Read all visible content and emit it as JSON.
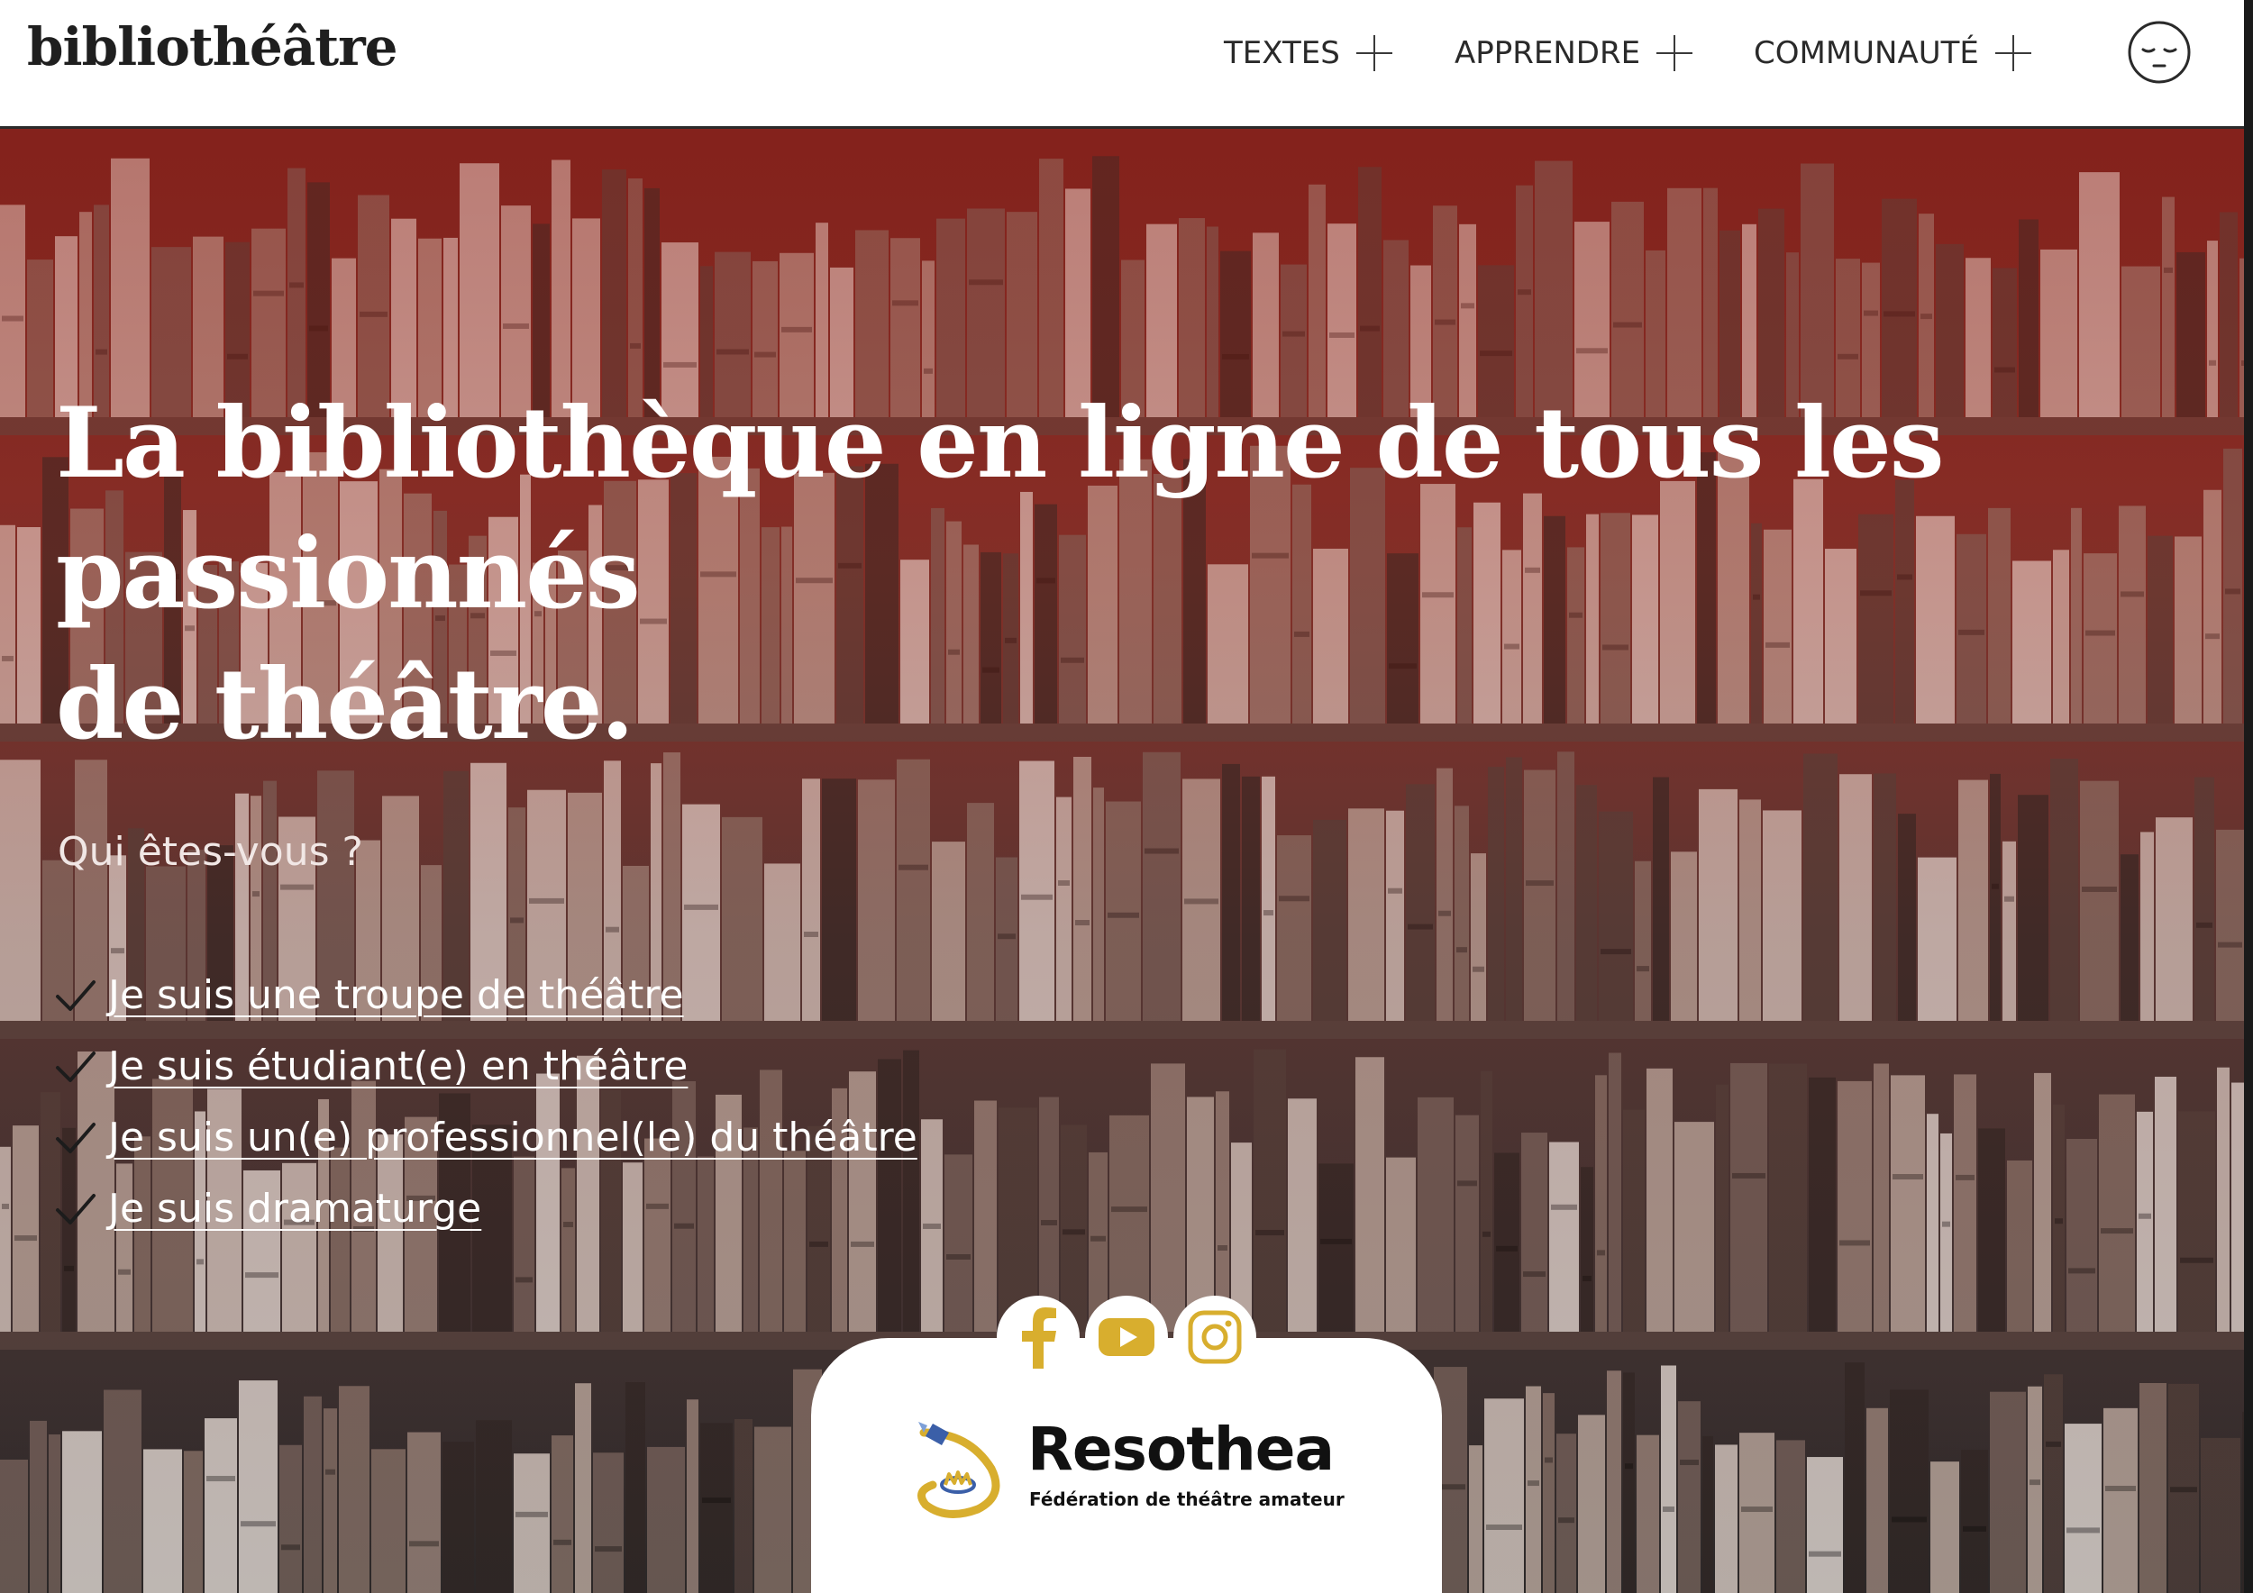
{
  "header": {
    "logo": "bibliothéâtre",
    "nav": [
      {
        "label": "TEXTES"
      },
      {
        "label": "APPRENDRE"
      },
      {
        "label": "COMMUNAUTÉ"
      }
    ],
    "user_icon": "sleepy-face-icon"
  },
  "hero": {
    "title_line1": "La bibliothèque en ligne de tous les passionnés",
    "title_line2": "de théâtre.",
    "question": "Qui êtes-vous ?",
    "choices": [
      {
        "label": "Je suis une troupe de théâtre"
      },
      {
        "label": "Je suis étudiant(e) en théâtre"
      },
      {
        "label": "Je suis un(e) professionnel(le) du théâtre"
      },
      {
        "label": "Je suis dramaturge"
      }
    ],
    "check_icon": "checkmark-icon"
  },
  "footer": {
    "social": [
      {
        "icon": "facebook-icon"
      },
      {
        "icon": "youtube-icon"
      },
      {
        "icon": "instagram-icon"
      }
    ],
    "partner_name": "Resothea",
    "partner_tagline": "Fédération de théâtre amateur"
  },
  "colors": {
    "accent_gold": "#d8ae2e",
    "hero_red": "#8c2018",
    "text_dark": "#1f1f1f",
    "white": "#ffffff"
  }
}
